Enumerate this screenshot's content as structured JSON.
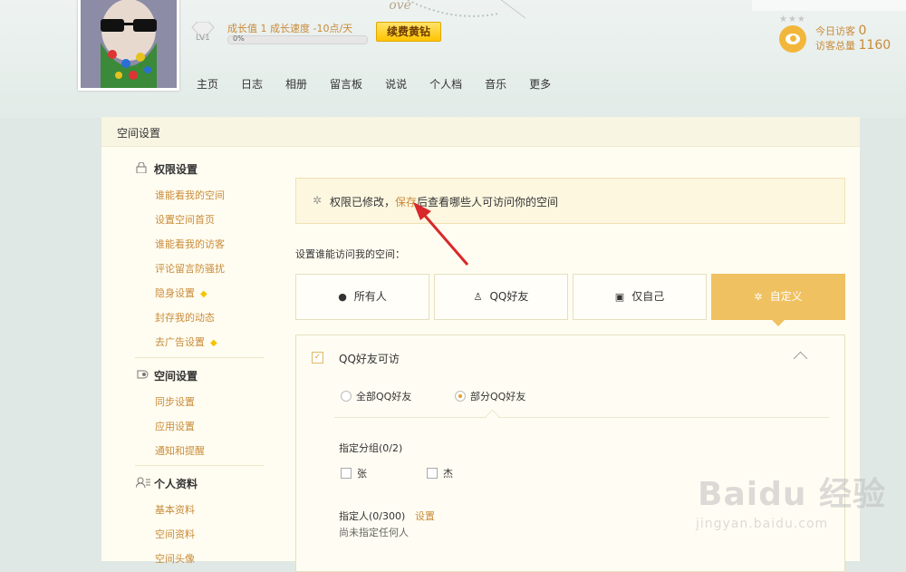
{
  "header": {
    "level": "LV1",
    "growth_text": "成长值 1   成长速度 -10点/天",
    "progress_percent": 0,
    "progress_label": "0%",
    "renew_button": "续费黄钻",
    "deco_text": "Love"
  },
  "visitors": {
    "today_label": "今日访客",
    "today_count": "0",
    "total_label": "访客总量",
    "total_count": "1160"
  },
  "nav": [
    "主页",
    "日志",
    "相册",
    "留言板",
    "说说",
    "个人档",
    "音乐",
    "更多"
  ],
  "panel": {
    "title": "空间设置"
  },
  "sidebar": {
    "groups": [
      {
        "title": "权限设置",
        "icon": "lock-icon",
        "items": [
          "谁能看我的空间",
          "设置空间首页",
          "谁能看我的访客",
          "评论留言防骚扰",
          "隐身设置",
          "封存我的动态",
          "去广告设置"
        ]
      },
      {
        "title": "空间设置",
        "icon": "space-icon",
        "items": [
          "同步设置",
          "应用设置",
          "通知和提醒"
        ]
      },
      {
        "title": "个人资料",
        "icon": "profile-icon",
        "items": [
          "基本资料",
          "空间资料",
          "空间头像"
        ]
      }
    ]
  },
  "notice": {
    "before": "权限已修改，",
    "link": "保存",
    "after": "后查看哪些人可访问你的空间"
  },
  "access": {
    "label": "设置谁能访问我的空间：",
    "options": [
      "所有人",
      "QQ好友",
      "仅自己",
      "自定义"
    ],
    "selected": "自定义"
  },
  "custom": {
    "qq_friends_label": "QQ好友可访",
    "radio_all": "全部QQ好友",
    "radio_part": "部分QQ好友",
    "group_label": "指定分组(0/2)",
    "groups": [
      "张",
      "杰"
    ],
    "person_label": "指定人(0/300)",
    "person_set": "设置",
    "person_none": "尚未指定任何人"
  },
  "watermark": {
    "brand": "Baidu 经验",
    "url": "jingyan.baidu.com"
  },
  "colors": {
    "accent": "#f0c161",
    "link": "#c98b3a",
    "panel_bg": "#fffdf1"
  }
}
